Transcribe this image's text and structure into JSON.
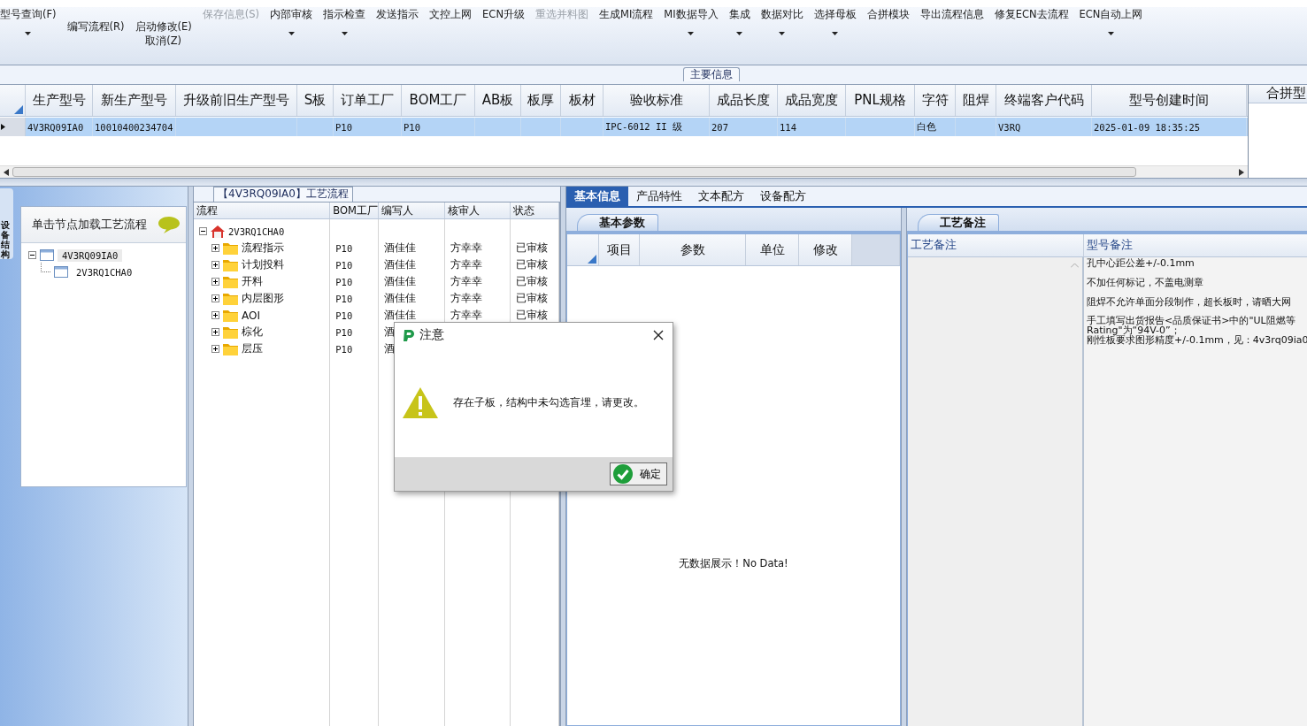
{
  "toolbar": {
    "items": [
      {
        "kind": "large",
        "lines": [
          "型号查询(F)"
        ],
        "dropdown": true,
        "disabled": false
      },
      {
        "kind": "small",
        "lines": [
          "编写流程(R)"
        ],
        "dropdown": false,
        "disabled": false
      },
      {
        "kind": "small",
        "lines": [
          "启动修改(E)",
          "取消(Z)"
        ],
        "dropdown": false,
        "disabled": false
      },
      {
        "kind": "large",
        "lines": [
          "保存信息(S)"
        ],
        "dropdown": false,
        "disabled": true
      },
      {
        "kind": "large",
        "lines": [
          "内部审核"
        ],
        "dropdown": true,
        "disabled": false
      },
      {
        "kind": "large",
        "lines": [
          "指示检查"
        ],
        "dropdown": true,
        "disabled": false
      },
      {
        "kind": "large",
        "lines": [
          "发送指示"
        ],
        "dropdown": false,
        "disabled": false
      },
      {
        "kind": "large",
        "lines": [
          "文控上网"
        ],
        "dropdown": false,
        "disabled": false
      },
      {
        "kind": "large",
        "lines": [
          "ECN升级"
        ],
        "dropdown": false,
        "disabled": false
      },
      {
        "kind": "large",
        "lines": [
          "重选并料图"
        ],
        "dropdown": false,
        "disabled": true
      },
      {
        "kind": "large",
        "lines": [
          "生成MI流程"
        ],
        "dropdown": false,
        "disabled": false
      },
      {
        "kind": "large",
        "lines": [
          "MI数据导入"
        ],
        "dropdown": true,
        "disabled": false
      },
      {
        "kind": "large",
        "lines": [
          "集成"
        ],
        "dropdown": true,
        "disabled": false
      },
      {
        "kind": "large",
        "lines": [
          "数据对比"
        ],
        "dropdown": true,
        "disabled": false
      },
      {
        "kind": "large",
        "lines": [
          "选择母板"
        ],
        "dropdown": true,
        "disabled": false
      },
      {
        "kind": "large",
        "lines": [
          "合拼模块"
        ],
        "dropdown": false,
        "disabled": false
      },
      {
        "kind": "large",
        "lines": [
          "导出流程信息"
        ],
        "dropdown": false,
        "disabled": false
      },
      {
        "kind": "large",
        "lines": [
          "修复ECN去流程"
        ],
        "dropdown": false,
        "disabled": false
      },
      {
        "kind": "large",
        "lines": [
          "ECN自动上网"
        ],
        "dropdown": true,
        "disabled": false
      }
    ]
  },
  "main_info": {
    "title": "主要信息",
    "columns": [
      "生产型号",
      "新生产型号",
      "升级前旧生产型号",
      "S板",
      "订单工厂",
      "BOM工厂",
      "AB板",
      "板厚",
      "板材",
      "验收标准",
      "成品长度",
      "成品宽度",
      "PNL规格",
      "字符",
      "阻焊",
      "终端客户代码",
      "型号创建时间"
    ],
    "rows": [
      {
        "selected": true,
        "cells": [
          "4V3RQ09IA0",
          "10010400234704",
          "",
          "",
          "P10",
          "P10",
          "",
          "",
          "",
          "IPC-6012 II 级",
          "207",
          "114",
          "",
          "白色",
          "",
          "V3RQ",
          "2025-01-09 18:35:25"
        ]
      }
    ],
    "side_panel": {
      "title": "合拼型"
    }
  },
  "left_panel": {
    "side_tab": "设备结构",
    "header": "单击节点加载工艺流程",
    "tree": [
      {
        "label": "4V3RQ09IA0",
        "expanded": true,
        "selected": true,
        "children": [
          {
            "label": "2V3RQ1CHA0",
            "selected": false
          }
        ]
      }
    ]
  },
  "process": {
    "title": "【4V3RQ09IA0】工艺流程",
    "columns": [
      "流程",
      "BOM工厂",
      "编写人",
      "核审人",
      "状态"
    ],
    "root": {
      "label": "2V3RQ1CHA0",
      "expanded": true
    },
    "steps": [
      {
        "label": "流程指示",
        "expanded": false,
        "bom": "P10",
        "writer": "酒佳佳",
        "reviewer": "方幸幸",
        "status": "已审核"
      },
      {
        "label": "计划投料",
        "expanded": false,
        "bom": "P10",
        "writer": "酒佳佳",
        "reviewer": "方幸幸",
        "status": "已审核"
      },
      {
        "label": "开料",
        "expanded": false,
        "bom": "P10",
        "writer": "酒佳佳",
        "reviewer": "方幸幸",
        "status": "已审核"
      },
      {
        "label": "内层图形",
        "expanded": false,
        "bom": "P10",
        "writer": "酒佳佳",
        "reviewer": "方幸幸",
        "status": "已审核"
      },
      {
        "label": "AOI",
        "expanded": false,
        "bom": "P10",
        "writer": "酒佳佳",
        "reviewer": "方幸幸",
        "status": "已审核"
      },
      {
        "label": "棕化",
        "expanded": false,
        "bom": "P10",
        "writer": "酒"
      },
      {
        "label": "层压",
        "expanded": false,
        "bom": "P10",
        "writer": "酒"
      }
    ]
  },
  "detail_tabs": [
    {
      "label": "基本信息",
      "selected": true
    },
    {
      "label": "产品特性",
      "selected": false
    },
    {
      "label": "文本配方",
      "selected": false
    },
    {
      "label": "设备配方",
      "selected": false
    }
  ],
  "basic_params": {
    "title": "基本参数",
    "columns": [
      "项目",
      "参数",
      "单位",
      "修改"
    ],
    "empty_text": "无数据展示！No Data!"
  },
  "process_notes": {
    "title": "工艺备注",
    "columns": [
      "工艺备注",
      "型号备注"
    ],
    "notes": [
      {
        "lines": [
          "孔中心距公差+/-0.1mm"
        ]
      },
      {
        "lines": [
          "不加任何标记，不盖电测章"
        ]
      },
      {
        "lines": [
          "阻焊不允许单面分段制作，超长板时，请晒大网"
        ]
      },
      {
        "lines": [
          "手工填写出货报告<品质保证书>中的\"UL阻燃等",
          "Rating\"为“94V-0”；",
          "刚性板要求图形精度+/-0.1mm，见：4v3rq09ia0"
        ]
      }
    ]
  },
  "dialog": {
    "title": "注意",
    "message": "存在子板，结构中未勾选盲埋，请更改。",
    "button": "确定"
  }
}
